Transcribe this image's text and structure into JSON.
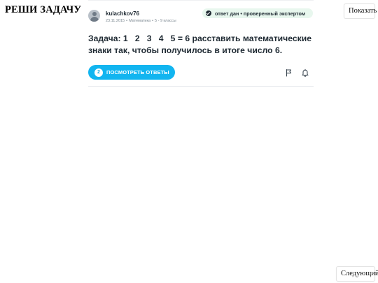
{
  "header": {
    "title": "РЕШИ ЗАДАЧУ",
    "show_button": "Показать"
  },
  "card": {
    "author": "kulachkov76",
    "date": "23.11.2015",
    "subject": "Математика",
    "grade": "5 - 9 классы",
    "verified_text": "ответ дан • проверенный экспертом",
    "question": "Задача: 1   2   3   4   5 = 6 расставить математические знаки так, чтобы получилось в итоге число 6.",
    "answers_count": "2",
    "answers_button": "ПОСМОТРЕТЬ ОТВЕТЫ"
  },
  "footer": {
    "next_button": "Следующий"
  },
  "colors": {
    "accent": "#12b5f0",
    "verified_bg": "#e8f7ee",
    "text_dark": "#1f2a33"
  },
  "icons": {
    "avatar": "user-avatar-icon",
    "verified": "check-circle-icon",
    "flag": "flag-icon",
    "bell": "bell-icon"
  }
}
